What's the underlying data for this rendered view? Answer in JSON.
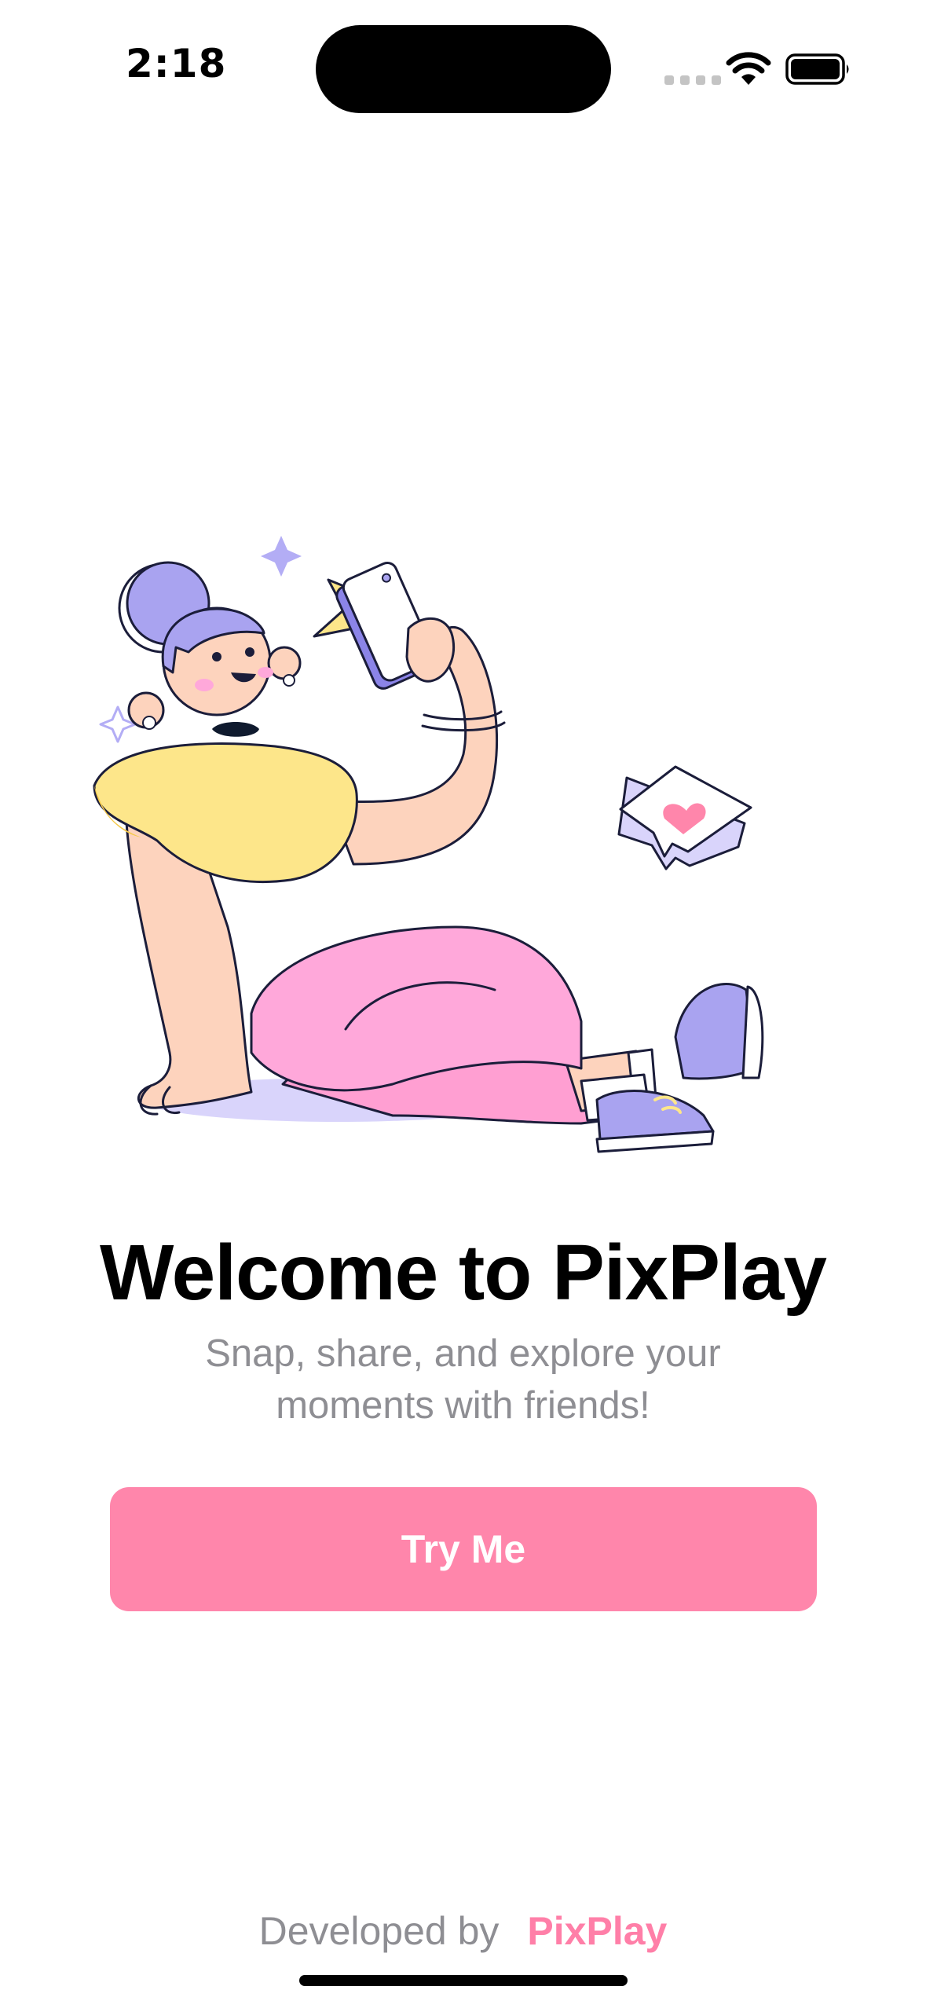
{
  "status_bar": {
    "time": "2:18",
    "wifi_icon": "wifi-icon",
    "battery_icon": "battery-icon",
    "signal_icon": "cellular-signal-icon"
  },
  "illustration": {
    "icon": "person-taking-selfie-illustration"
  },
  "welcome": {
    "title": "Welcome to PixPlay",
    "subtitle": "Snap, share, and explore your moments with friends!"
  },
  "cta": {
    "label": "Try Me"
  },
  "footer": {
    "developed_by": "Developed by",
    "brand": "PixPlay"
  },
  "colors": {
    "accent": "#ff86ab",
    "brand_text": "#ff7fa8",
    "secondary_text": "#8e8e93",
    "illustration_purple": "#a9a3f0",
    "illustration_pink": "#ffa8da",
    "illustration_yellow": "#fde68a",
    "illustration_skin": "#fdd3bd"
  }
}
